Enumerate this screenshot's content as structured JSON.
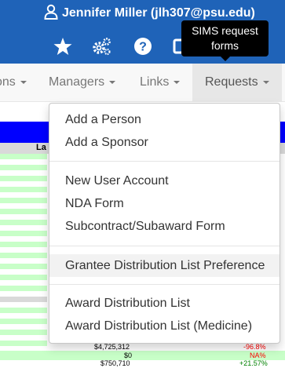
{
  "header": {
    "user_label": "Jennifer Miller (jlh307@psu.edu)",
    "icons": [
      "user-icon",
      "star-icon",
      "cogs-icon",
      "help-icon",
      "forms-icon"
    ]
  },
  "tooltip": {
    "text_line1": "SIMS request",
    "text_line2": "forms"
  },
  "nav": {
    "items": [
      {
        "label": "ons"
      },
      {
        "label": "Managers"
      },
      {
        "label": "Links"
      },
      {
        "label": "Requests"
      }
    ],
    "active": "Requests"
  },
  "dropdown": {
    "groups": [
      [
        "Add a Person",
        "Add a Sponsor"
      ],
      [
        "New User Account",
        "NDA Form",
        "Subcontract/Subaward Form"
      ],
      [
        "Grantee Distribution List Preference"
      ],
      [
        "Award Distribution List",
        "Award Distribution List (Medicine)"
      ]
    ],
    "highlighted": "Grantee Distribution List Preference"
  },
  "background_table": {
    "header_fragment": "La",
    "rows": [
      {
        "amount": "$4,725,312",
        "pct": "-96.8%"
      },
      {
        "amount": "$0",
        "pct": "NA%"
      },
      {
        "amount": "$750,710",
        "pct": "+21.57%"
      }
    ]
  },
  "colors": {
    "header_blue": "#1f63b8",
    "table_header_blue": "#0000ff",
    "row_green": "#c8ffc8",
    "negative_red": "#ff0000",
    "positive_green": "#008000"
  }
}
